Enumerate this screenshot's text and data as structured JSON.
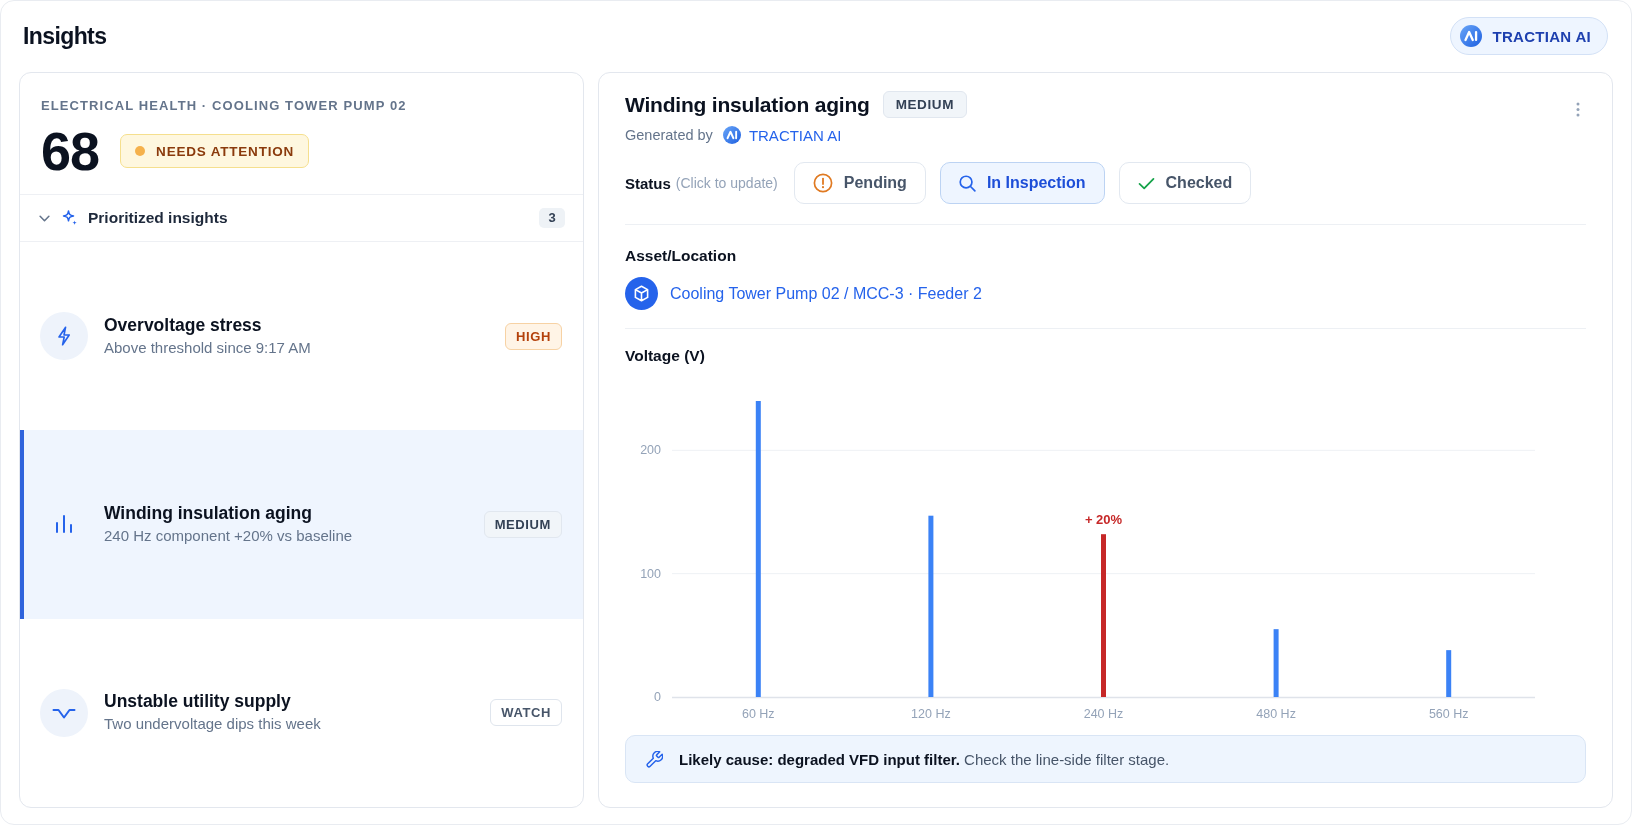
{
  "header": {
    "title": "Insights",
    "assistant_button": {
      "label": "TRACTIAN AI"
    }
  },
  "health": {
    "kicker": "ELECTRICAL HEALTH · COOLING TOWER PUMP 02",
    "score": "68",
    "status": {
      "label": "NEEDS ATTENTION",
      "kind": "warning"
    }
  },
  "insights": {
    "title": "Prioritized insights",
    "count": "3",
    "expanded": true,
    "items": [
      {
        "kind": "overvoltage",
        "title": "Overvoltage stress",
        "subtitle": "Above threshold since 9:17 AM",
        "badge": {
          "label": "HIGH",
          "kind": "high"
        },
        "selected": false
      },
      {
        "kind": "harmonic",
        "title": "Winding insulation aging",
        "subtitle": "240 Hz component +20% vs baseline",
        "badge": {
          "label": "MEDIUM",
          "kind": "medium"
        },
        "selected": true
      },
      {
        "kind": "undervoltage",
        "title": "Unstable utility supply",
        "subtitle": "Two undervoltage dips this week",
        "badge": {
          "label": "WATCH",
          "kind": "watch"
        },
        "selected": false
      }
    ]
  },
  "detail": {
    "title": "Winding insulation aging",
    "severity": {
      "label": "MEDIUM",
      "kind": "medium"
    },
    "generated_by": {
      "label": "Generated by",
      "source": "TRACTIAN AI"
    },
    "status": {
      "label": "Status",
      "hint": "(Click to update)",
      "options": [
        {
          "label": "Pending",
          "kind": "pending",
          "selected": false
        },
        {
          "label": "In Inspection",
          "kind": "inspection",
          "selected": true
        },
        {
          "label": "Checked",
          "kind": "checked",
          "selected": false
        }
      ]
    },
    "asset": {
      "label": "Asset/Location",
      "path": "Cooling Tower Pump 02 / MCC-3 · Feeder 2"
    },
    "chart_data": {
      "type": "bar",
      "title": "Voltage (V)",
      "categories": [
        "60 Hz",
        "120 Hz",
        "240 Hz",
        "480 Hz",
        "560 Hz"
      ],
      "series": [
        {
          "color": "#3b82f6",
          "values": [
            240,
            147,
            null,
            55,
            38
          ]
        },
        {
          "color": "#c62828",
          "values": [
            null,
            null,
            132,
            null,
            null
          ]
        }
      ],
      "ylim": [
        0,
        240
      ],
      "yticks": [
        0,
        100,
        200
      ],
      "value_labels": [
        null,
        null,
        "+ 20%",
        null,
        null
      ]
    },
    "cause": "**Likely cause: degraded VFD input filter.** Check the line-side filter stage."
  }
}
